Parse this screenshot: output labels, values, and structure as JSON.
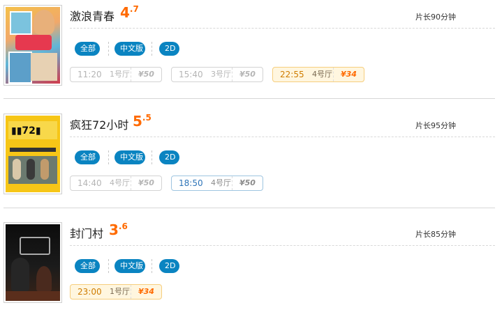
{
  "movies": [
    {
      "title": "激浪青春",
      "score_int": "4",
      "score_dec": ".7",
      "duration": "片长90分钟",
      "tags": [
        "全部",
        "中文版",
        "2D"
      ],
      "showtimes": [
        {
          "time": "11:20",
          "hall": "1号厅",
          "price": "¥50",
          "state": "past"
        },
        {
          "time": "15:40",
          "hall": "3号厅",
          "price": "¥50",
          "state": "past"
        },
        {
          "time": "22:55",
          "hall": "4号厅",
          "price": "¥34",
          "state": "hot"
        }
      ]
    },
    {
      "title": "疯狂72小时",
      "score_int": "5",
      "score_dec": ".5",
      "duration": "片长95分钟",
      "tags": [
        "全部",
        "中文版",
        "2D"
      ],
      "showtimes": [
        {
          "time": "14:40",
          "hall": "4号厅",
          "price": "¥50",
          "state": "past"
        },
        {
          "time": "18:50",
          "hall": "4号厅",
          "price": "¥50",
          "state": "active"
        }
      ]
    },
    {
      "title": "封门村",
      "score_int": "3",
      "score_dec": ".6",
      "duration": "片长85分钟",
      "tags": [
        "全部",
        "中文版",
        "2D"
      ],
      "showtimes": [
        {
          "time": "23:00",
          "hall": "1号厅",
          "price": "¥34",
          "state": "hot"
        }
      ]
    }
  ],
  "colors": {
    "accent": "#ff6a00",
    "tag_bg": "#0a84c1",
    "hot_bg": "#fff6df"
  }
}
